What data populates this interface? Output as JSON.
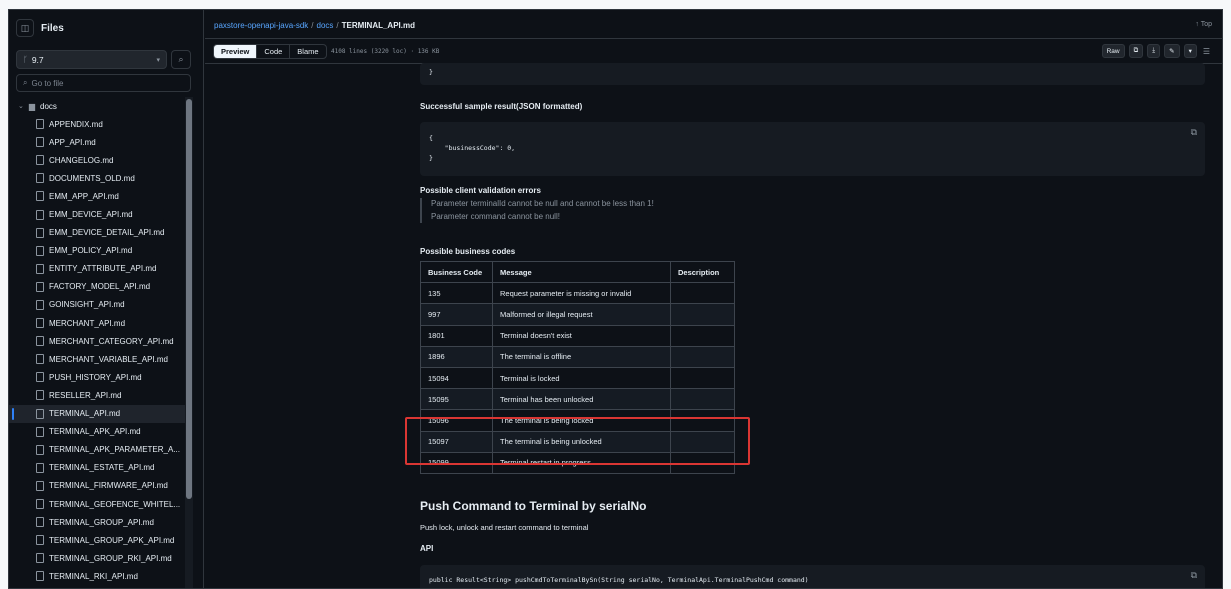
{
  "sidebar": {
    "title": "Files",
    "branch": "9.7",
    "search_placeholder": "Go to file",
    "folder": "docs",
    "files": [
      "APPENDIX.md",
      "APP_API.md",
      "CHANGELOG.md",
      "DOCUMENTS_OLD.md",
      "EMM_APP_API.md",
      "EMM_DEVICE_API.md",
      "EMM_DEVICE_DETAIL_API.md",
      "EMM_POLICY_API.md",
      "ENTITY_ATTRIBUTE_API.md",
      "FACTORY_MODEL_API.md",
      "GOINSIGHT_API.md",
      "MERCHANT_API.md",
      "MERCHANT_CATEGORY_API.md",
      "MERCHANT_VARIABLE_API.md",
      "PUSH_HISTORY_API.md",
      "RESELLER_API.md",
      "TERMINAL_API.md",
      "TERMINAL_APK_API.md",
      "TERMINAL_APK_PARAMETER_A...",
      "TERMINAL_ESTATE_API.md",
      "TERMINAL_FIRMWARE_API.md",
      "TERMINAL_GEOFENCE_WHITEL...",
      "TERMINAL_GROUP_API.md",
      "TERMINAL_GROUP_APK_API.md",
      "TERMINAL_GROUP_RKI_API.md",
      "TERMINAL_RKI_API.md"
    ],
    "active_file": "TERMINAL_API.md"
  },
  "breadcrumb": {
    "repo": "paxstore-openapi-java-sdk",
    "sep1": "/",
    "folder": "docs",
    "sep2": "/",
    "file": "TERMINAL_API.md"
  },
  "top_link": "↑ Top",
  "toolbar": {
    "preview": "Preview",
    "code": "Code",
    "blame": "Blame",
    "info": "4108 lines (3220 loc) · 136 KB",
    "raw": "Raw"
  },
  "content": {
    "top_code_tail": "}",
    "success_heading": "Successful sample result(JSON formatted)",
    "success_code": [
      "{",
      "    \"businessCode\": 0,",
      "}"
    ],
    "validation_heading": "Possible client validation errors",
    "validation_errors": [
      "Parameter terminalId cannot be null and cannot be less than 1!",
      "Parameter command cannot be null!"
    ],
    "business_heading": "Possible business codes",
    "table": {
      "headers": [
        "Business Code",
        "Message",
        "Description"
      ],
      "rows": [
        [
          "135",
          "Request parameter is missing or invalid",
          ""
        ],
        [
          "997",
          "Malformed or illegal request",
          ""
        ],
        [
          "1801",
          "Terminal doesn't exist",
          ""
        ],
        [
          "1896",
          "The terminal is offline",
          ""
        ],
        [
          "15094",
          "Terminal is locked",
          ""
        ],
        [
          "15095",
          "Terminal has been unlocked",
          ""
        ],
        [
          "15096",
          "The terminal is being locked",
          ""
        ],
        [
          "15097",
          "The terminal is being unlocked",
          ""
        ],
        [
          "15099",
          "Terminal restart in progress",
          ""
        ]
      ]
    },
    "section_title": "Push Command to Terminal by serialNo",
    "section_desc": "Push lock, unlock and restart command to terminal",
    "api_heading": "API",
    "api_code": "public Result<String> pushCmdToTerminalBySn(String serialNo, TerminalApi.TerminalPushCmd command)"
  },
  "colors": {
    "background": "#0d1117",
    "link": "#58a6ff",
    "highlight_box": "#da3633"
  }
}
